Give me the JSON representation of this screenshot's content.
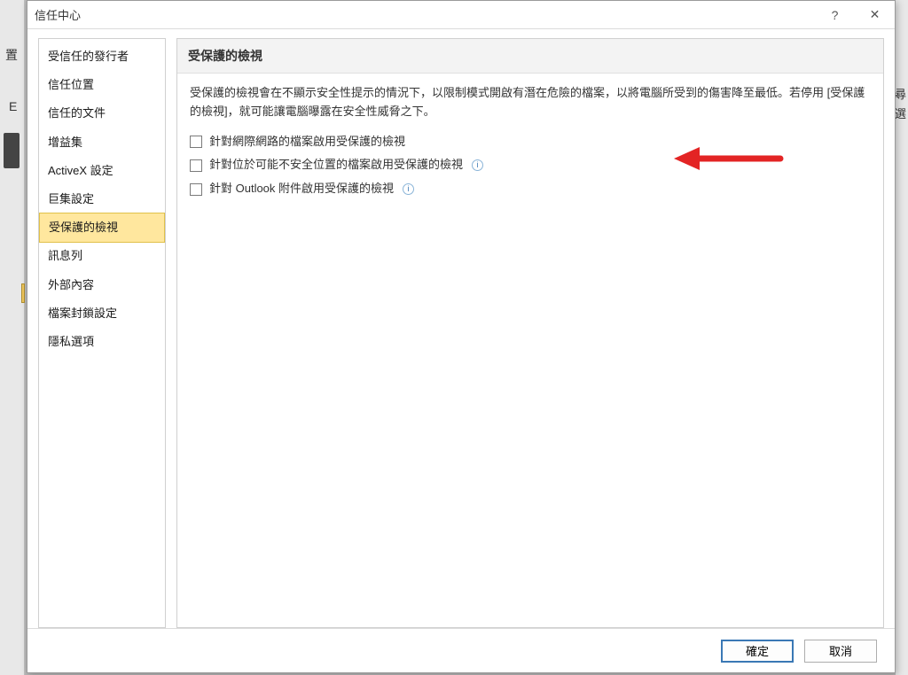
{
  "dialog": {
    "title": "信任中心",
    "help_tooltip": "?",
    "close_tooltip": "✕"
  },
  "sidebar": {
    "items": [
      {
        "label": "受信任的發行者"
      },
      {
        "label": "信任位置"
      },
      {
        "label": "信任的文件"
      },
      {
        "label": "增益集"
      },
      {
        "label": "ActiveX 設定"
      },
      {
        "label": "巨集設定"
      },
      {
        "label": "受保護的檢視"
      },
      {
        "label": "訊息列"
      },
      {
        "label": "外部內容"
      },
      {
        "label": "檔案封鎖設定"
      },
      {
        "label": "隱私選項"
      }
    ],
    "selected_index": 6
  },
  "content": {
    "section_title": "受保護的檢視",
    "description": "受保護的檢視會在不顯示安全性提示的情況下，以限制模式開啟有潛在危險的檔案，以將電腦所受到的傷害降至最低。若停用 [受保護的檢視]，就可能讓電腦曝露在安全性威脅之下。",
    "checkboxes": [
      {
        "label": "針對網際網路的檔案啟用受保護的檢視",
        "checked": false,
        "has_info": false
      },
      {
        "label": "針對位於可能不安全位置的檔案啟用受保護的檢視",
        "checked": false,
        "has_info": true
      },
      {
        "label": "針對 Outlook 附件啟用受保護的檢視",
        "checked": false,
        "has_info": true
      }
    ]
  },
  "footer": {
    "ok_label": "確定",
    "cancel_label": "取消"
  },
  "bg": {
    "char1": "置",
    "char2": "E",
    "rchar1": "尋",
    "rchar2": "選"
  },
  "colors": {
    "selected_bg": "#ffe79e",
    "selected_border": "#e0c14a",
    "primary_border": "#3a78b5",
    "arrow": "#e32424"
  }
}
